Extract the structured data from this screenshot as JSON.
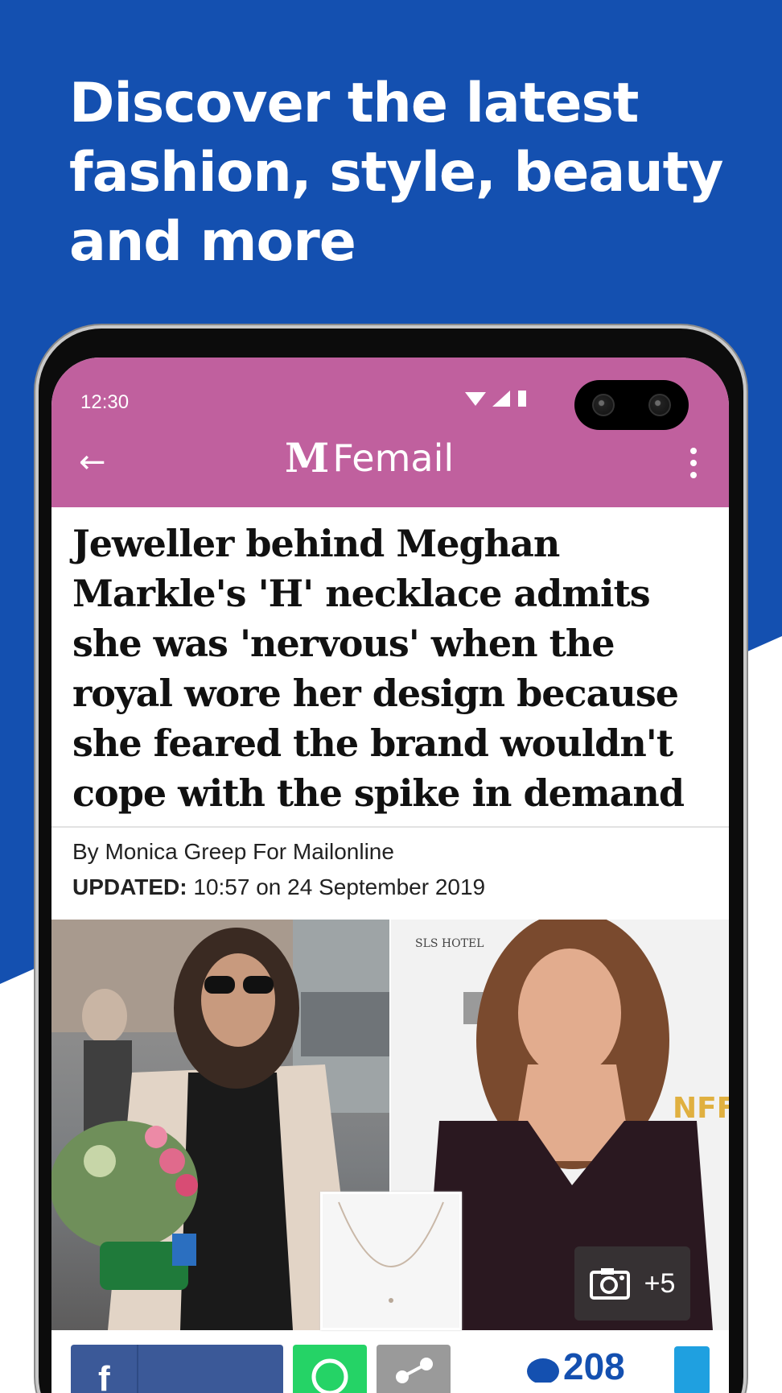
{
  "promo": {
    "headline": "Discover the latest fashion, style, beauty and more"
  },
  "colors": {
    "promo_blue": "#1450b0",
    "femail_pink": "#c0609e",
    "facebook_blue": "#3b5998",
    "whatsapp_green": "#25d366",
    "share_grey": "#9a9a9a",
    "comments_blue": "#1450b0"
  },
  "status_bar": {
    "time": "12:30",
    "icons": [
      "wifi-icon",
      "signal-icon",
      "battery-icon"
    ]
  },
  "app_bar": {
    "back_icon": "back-arrow-icon",
    "logo_mark": "M",
    "section": "Femail",
    "menu_icon": "more-vert-icon"
  },
  "article": {
    "title": "Jeweller behind Meghan Markle's 'H' necklace admits she was 'nervous' when the royal wore her design because she feared the brand wouldn't cope with the spike in demand",
    "byline": "By Monica Greep For Mailonline",
    "updated_label": "UPDATED:",
    "updated_value": "10:57 on 24 September 2019"
  },
  "photos": {
    "right_sign": "SLS HOTEL",
    "right_banner": "NFF",
    "gallery_count": "+5",
    "gallery_icon": "camera-icon"
  },
  "share_bar": {
    "facebook_icon": "facebook-icon",
    "whatsapp_icon": "whatsapp-icon",
    "share_icon": "share-icon",
    "comments_count": "208"
  }
}
